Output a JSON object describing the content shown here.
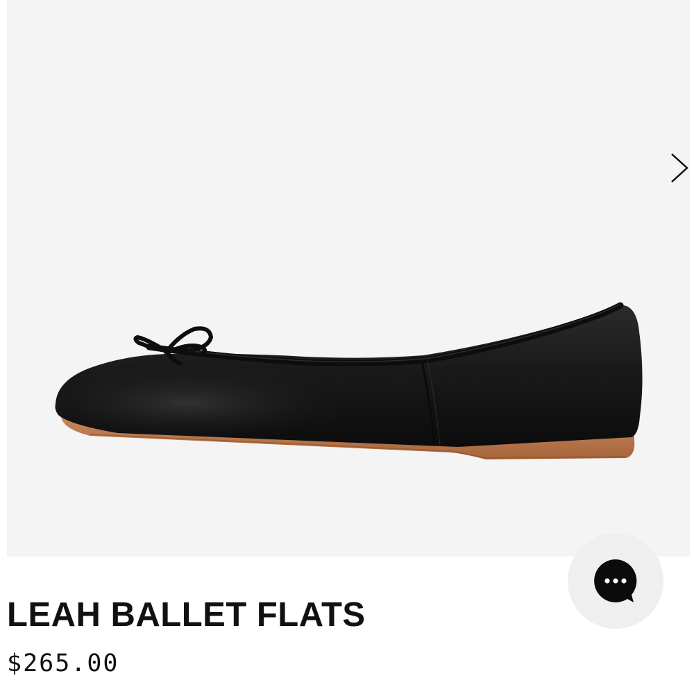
{
  "product": {
    "title": "LEAH BALLET FLATS",
    "price": "$265.00"
  },
  "gallery": {
    "background_color": "#f5f4f4",
    "next_icon": "chevron-right-icon"
  },
  "chat": {
    "icon": "chat-bubble-ellipsis-icon"
  }
}
